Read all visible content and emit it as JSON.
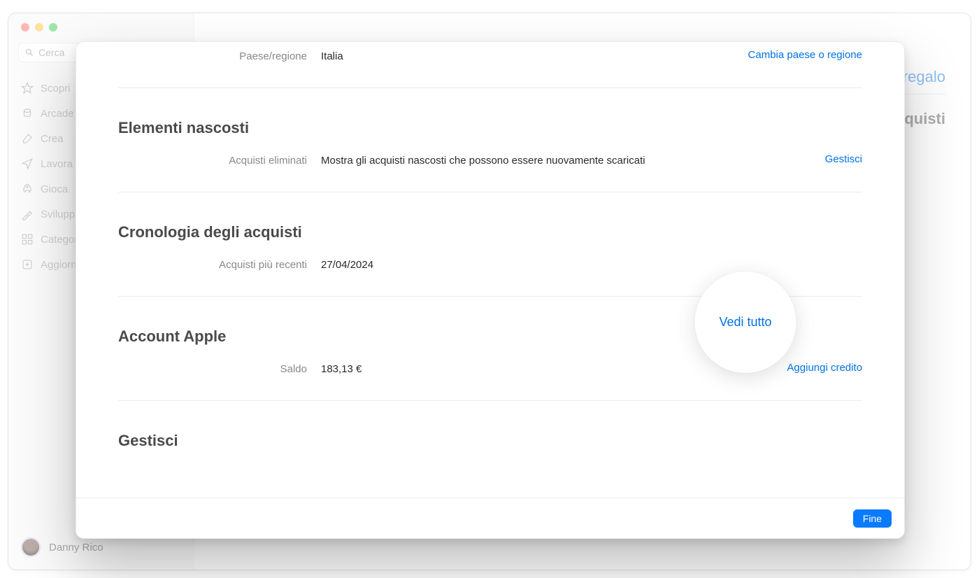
{
  "sidebar": {
    "search_placeholder": "Cerca",
    "items": [
      {
        "label": "Scopri"
      },
      {
        "label": "Arcade"
      },
      {
        "label": "Crea"
      },
      {
        "label": "Lavora"
      },
      {
        "label": "Gioca"
      },
      {
        "label": "Sviluppa"
      },
      {
        "label": "Categorie"
      },
      {
        "label": "Aggiornamenti"
      }
    ],
    "user_name": "Danny Rico"
  },
  "main_peek": {
    "link": "regalo",
    "heading": "Acquisti"
  },
  "modal": {
    "country_region": {
      "label": "Paese/regione",
      "value": "Italia",
      "action": "Cambia paese o regione"
    },
    "hidden_items": {
      "title": "Elementi nascosti",
      "row_label": "Acquisti eliminati",
      "row_value": "Mostra gli acquisti nascosti che possono essere nuovamente scaricati",
      "action": "Gestisci"
    },
    "purchase_history": {
      "title": "Cronologia degli acquisti",
      "row_label": "Acquisti più recenti",
      "row_value": "27/04/2024",
      "action": "Vedi tutto"
    },
    "apple_account": {
      "title": "Account Apple",
      "row_label": "Saldo",
      "row_value": "183,13 €",
      "action": "Aggiungi credito"
    },
    "manage": {
      "title": "Gestisci"
    },
    "done": "Fine"
  }
}
